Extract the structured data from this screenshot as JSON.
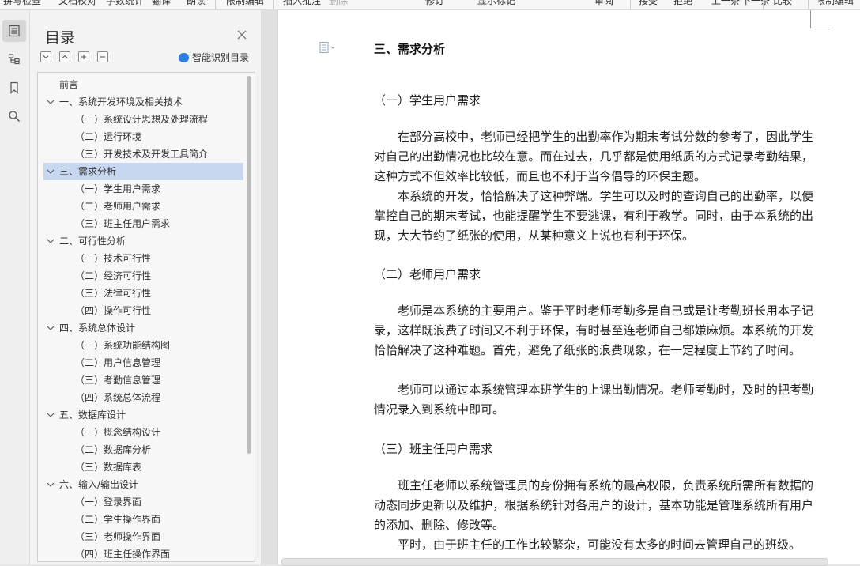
{
  "toolbar": {
    "items": [
      "拼写检查",
      "文档校对",
      "字数统计",
      "翻译",
      "朗读",
      "限制编辑",
      "插入批注",
      "删除",
      "修订",
      "显示标记",
      "审阅",
      "接受",
      "拒绝",
      "上一条",
      "下一条",
      "比较",
      "限制编辑"
    ]
  },
  "toc": {
    "title": "目录",
    "smart_label": "智能识别目录",
    "items": [
      {
        "label": "前言",
        "level": 0
      },
      {
        "label": "一、系统开发环境及相关技术",
        "level": 1
      },
      {
        "label": "（一）系统设计思想及处理流程",
        "level": 2
      },
      {
        "label": "（二）运行环境",
        "level": 2
      },
      {
        "label": "（三）开发技术及开发工具简介",
        "level": 2
      },
      {
        "label": "三、需求分析",
        "level": 1,
        "selected": true
      },
      {
        "label": "（一）学生用户需求",
        "level": 2
      },
      {
        "label": "（二）老师用户需求",
        "level": 2
      },
      {
        "label": "（三）班主任用户需求",
        "level": 2
      },
      {
        "label": "二、可行性分析",
        "level": 1
      },
      {
        "label": "（一）技术可行性",
        "level": 2
      },
      {
        "label": "（二）经济可行性",
        "level": 2
      },
      {
        "label": "（三）法律可行性",
        "level": 2
      },
      {
        "label": "（四）操作可行性",
        "level": 2
      },
      {
        "label": "四、系统总体设计",
        "level": 1
      },
      {
        "label": "（一）系统功能结构图",
        "level": 2
      },
      {
        "label": "（二）用户信息管理",
        "level": 2
      },
      {
        "label": "（三）考勤信息管理",
        "level": 2
      },
      {
        "label": "（四）系统总体流程",
        "level": 2
      },
      {
        "label": "五、数据库设计",
        "level": 1
      },
      {
        "label": "（一）概念结构设计",
        "level": 2
      },
      {
        "label": "（二）数据库分析",
        "level": 2
      },
      {
        "label": "（三）数据库表",
        "level": 2
      },
      {
        "label": "六、输入/输出设计",
        "level": 1
      },
      {
        "label": "（一）登录界面",
        "level": 2
      },
      {
        "label": "（二）学生操作界面",
        "level": 2
      },
      {
        "label": "（三）老师操作界面",
        "level": 2
      },
      {
        "label": "（四）班主任操作界面",
        "level": 2
      }
    ]
  },
  "document": {
    "heading": "三、需求分析",
    "sections": [
      {
        "title": "（一）学生用户需求"
      },
      {
        "title": "（二）老师用户需求"
      },
      {
        "title": "（三）班主任用户需求"
      }
    ],
    "paragraphs": [
      "在部分高校中，老师已经把学生的出勤率作为期末考试分数的参考了，因此学生对自己的出勤情况也比较在意。而在过去，几乎都是使用纸质的方式记录考勤结果，这种方式不但效率比较低，而且也不利于当今倡导的环保主题。",
      "本系统的开发，恰恰解决了这种弊端。学生可以及时的查询自己的出勤率，以便掌控自己的期末考试，也能提醒学生不要逃课，有利于教学。同时，由于本系统的出现，大大节约了纸张的使用，从某种意义上说也有利于环保。",
      "老师是本系统的主要用户。鉴于平时老师考勤多是自己或是让考勤班长用本子记录，这样既浪费了时间又不利于环保，有时甚至连老师自己都嫌麻烦。本系统的开发恰恰解决了这种难题。首先，避免了纸张的浪费现象，在一定程度上节约了时间。",
      "老师可以通过本系统管理本班学生的上课出勤情况。老师考勤时，及时的把考勤情况录入到系统中即可。",
      "班主任老师以系统管理员的身份拥有系统的最高权限，负责系统所需所有数据的动态同步更新以及维护，根据系统针对各用户的设计，基本功能是管理系统所有用户的添加、删除、修改等。",
      "平时，由于班主任的工作比较繁杂，可能没有太多的时间去管理自己的班级。"
    ]
  }
}
